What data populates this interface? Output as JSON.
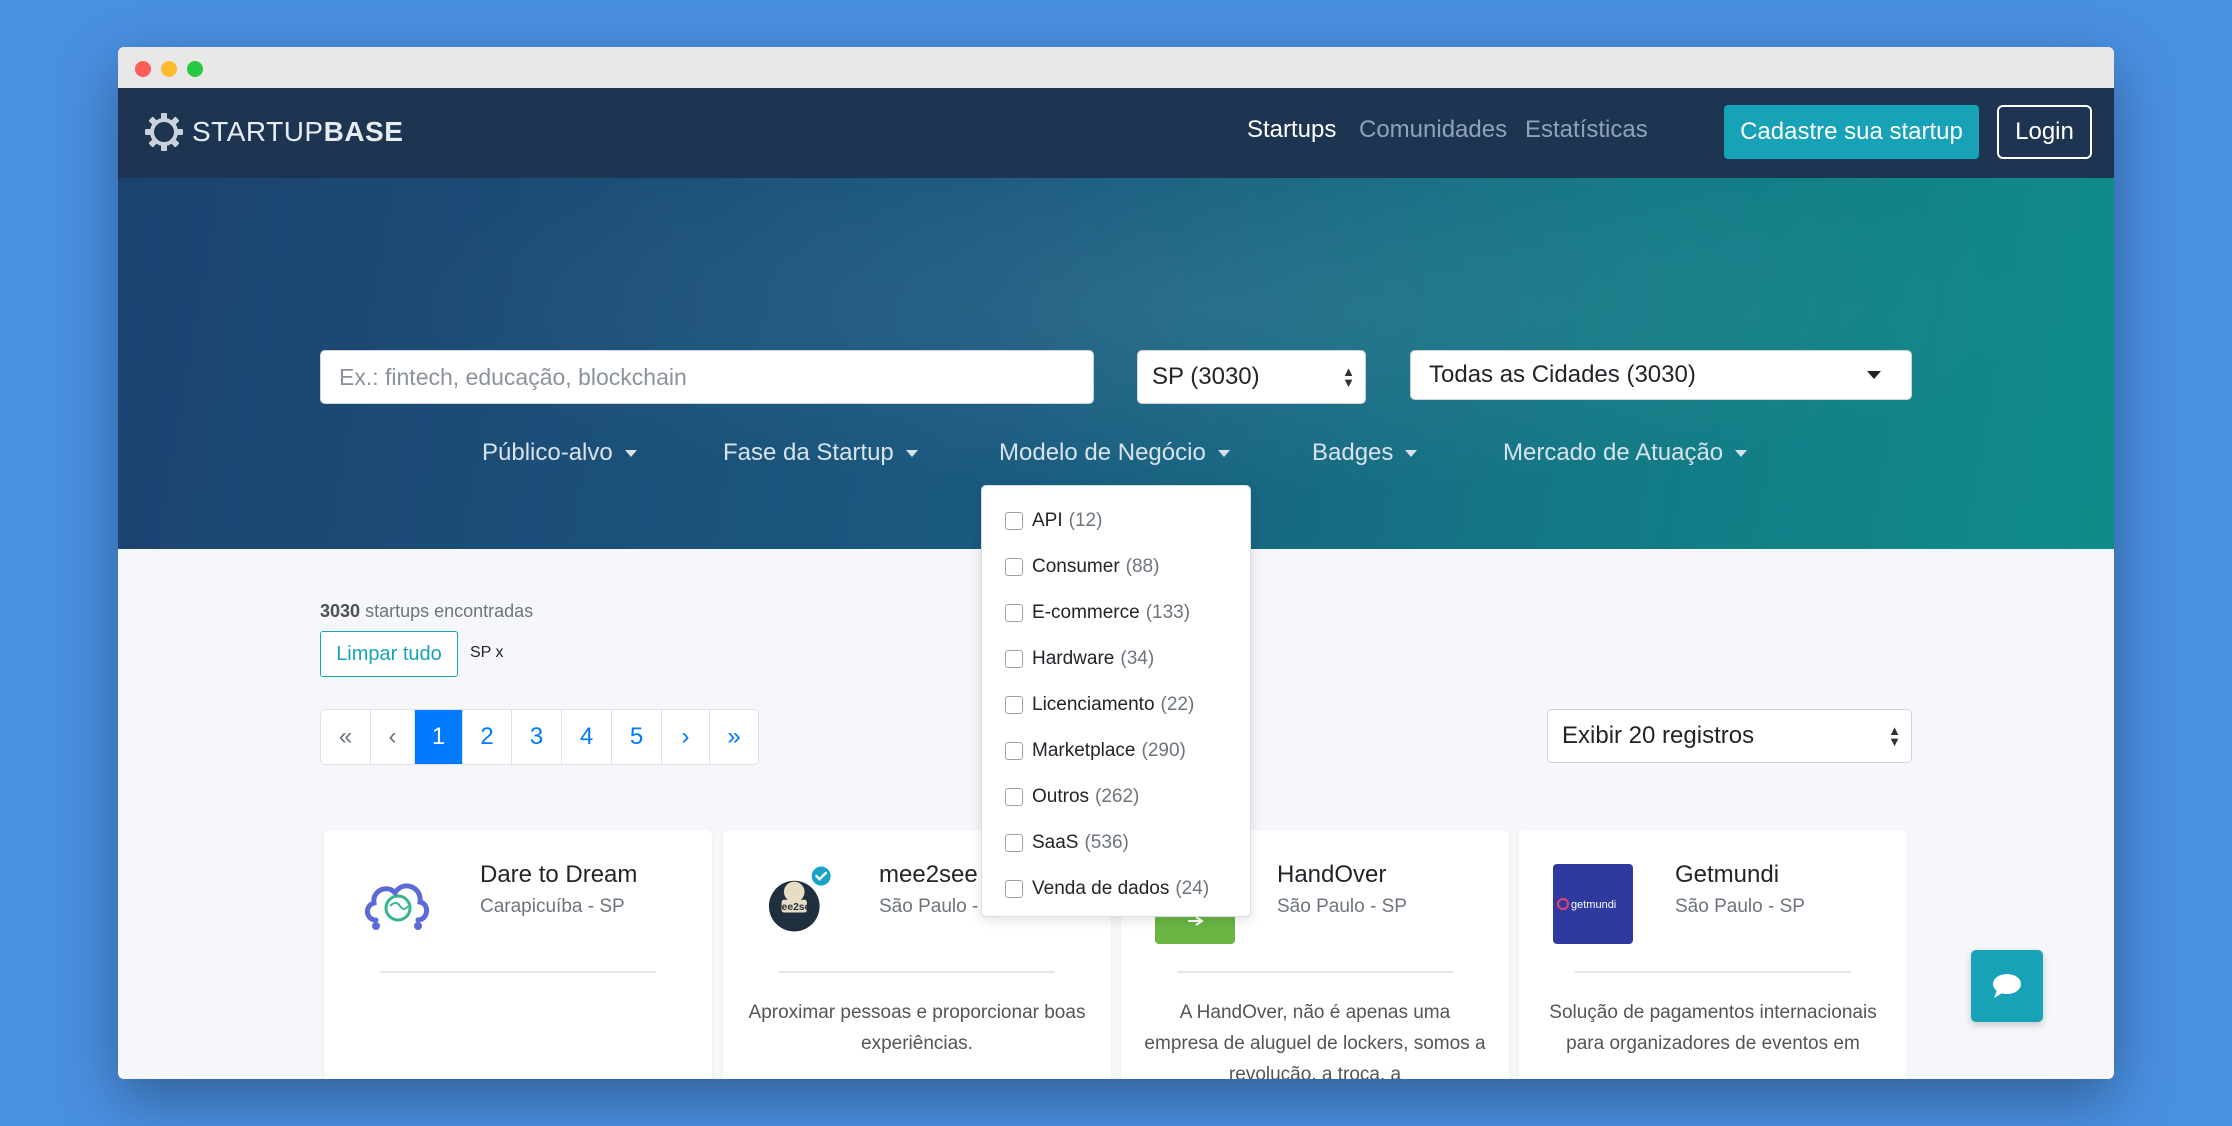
{
  "nav": {
    "logo_prefix": "STARTUP",
    "logo_suffix": "BASE",
    "links": [
      "Startups",
      "Comunidades",
      "Estatísticas"
    ],
    "register_label": "Cadastre sua startup",
    "login_label": "Login"
  },
  "hero": {
    "search_placeholder": "Ex.: fintech, educação, blockchain",
    "state_select": "SP (3030)",
    "city_select": "Todas as Cidades (3030)",
    "filters": [
      "Público-alvo",
      "Fase da Startup",
      "Modelo de Negócio",
      "Badges",
      "Mercado de Atuação"
    ]
  },
  "dropdown": {
    "items": [
      {
        "label": "API",
        "count": "(12)"
      },
      {
        "label": "Consumer",
        "count": "(88)"
      },
      {
        "label": "E-commerce",
        "count": "(133)"
      },
      {
        "label": "Hardware",
        "count": "(34)"
      },
      {
        "label": "Licenciamento",
        "count": "(22)"
      },
      {
        "label": "Marketplace",
        "count": "(290)"
      },
      {
        "label": "Outros",
        "count": "(262)"
      },
      {
        "label": "SaaS",
        "count": "(536)"
      },
      {
        "label": "Venda de dados",
        "count": "(24)"
      }
    ]
  },
  "results": {
    "count": "3030",
    "count_suffix": "startups encontradas",
    "clear_label": "Limpar tudo",
    "active_tag": "SP x",
    "records_select": "Exibir 20 registros"
  },
  "pagination": [
    "«",
    "‹",
    "1",
    "2",
    "3",
    "4",
    "5",
    "›",
    "»"
  ],
  "pagination_active": "1",
  "cards": [
    {
      "name": "Dare to Dream",
      "location": "Carapicuíba - SP",
      "description": ""
    },
    {
      "name": "mee2see",
      "location": "São Paulo - SP",
      "description": "Aproximar pessoas e proporcionar boas experiências.",
      "logo_text": "mee2see"
    },
    {
      "name": "HandOver",
      "location": "São Paulo - SP",
      "description": "A HandOver, não é apenas uma empresa de aluguel de lockers, somos a revolução, a troca, a"
    },
    {
      "name": "Getmundi",
      "location": "São Paulo - SP",
      "description": "Solução de pagamentos internacionais para organizadores de eventos em",
      "logo_text": "getmundi"
    }
  ],
  "colors": {
    "navbar": "#1e3552",
    "accent": "#17a2b8",
    "link": "#007bff",
    "background": "#4a90e2"
  }
}
